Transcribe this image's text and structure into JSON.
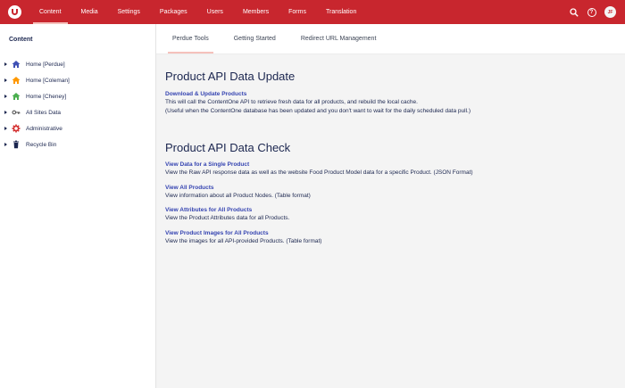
{
  "topbar": {
    "logo_name": "umbraco-logo",
    "nav": [
      {
        "label": "Content",
        "active": true
      },
      {
        "label": "Media"
      },
      {
        "label": "Settings"
      },
      {
        "label": "Packages"
      },
      {
        "label": "Users"
      },
      {
        "label": "Members"
      },
      {
        "label": "Forms"
      },
      {
        "label": "Translation"
      }
    ],
    "help_glyph": "?",
    "avatar_initials": "JF"
  },
  "sidebar": {
    "title": "Content",
    "items": [
      {
        "label": "Home [Perdue]",
        "icon": "home-icon",
        "color": "#3f51b5"
      },
      {
        "label": "Home [Coleman]",
        "icon": "home-icon",
        "color": "#ff9800"
      },
      {
        "label": "Home [Cheney]",
        "icon": "home-icon",
        "color": "#4caf50"
      },
      {
        "label": "All Sites Data",
        "icon": "key-icon",
        "color": "#555555"
      },
      {
        "label": "Administrative",
        "icon": "gear-icon",
        "color": "#d32f2f"
      },
      {
        "label": "Recycle Bin",
        "icon": "trash-icon",
        "color": "#1b264f"
      }
    ]
  },
  "main": {
    "tabs": [
      {
        "label": "Perdue Tools",
        "active": true
      },
      {
        "label": "Getting Started"
      },
      {
        "label": "Redirect URL Management"
      }
    ],
    "section1": {
      "title": "Product API Data Update",
      "entries": [
        {
          "link": "Download & Update Products",
          "desc1": "This will call the ContentOne API to retrieve fresh data for all products, and rebuild the local cache.",
          "desc2": "(Useful when the ContentOne database has been updated and you don't want to wait for the daily scheduled data pull.)"
        }
      ]
    },
    "section2": {
      "title": "Product API Data Check",
      "entries": [
        {
          "link": "View Data for a Single Product",
          "desc1": "View the Raw API response data as well as the website Food Product Model data for a specific Product. (JSON Format)"
        },
        {
          "link": "View All Products",
          "desc1": "View information about all Product Nodes. (Table format)"
        },
        {
          "link": "View Attributes for All Products",
          "desc1": "View the Product Attributes data for all Products."
        },
        {
          "link": "View Product Images for All Products",
          "desc1": "View the images for all API-provided Products. (Table format)"
        }
      ]
    }
  },
  "colors": {
    "topbar": "#c8262e",
    "link": "#3544b1",
    "text": "#1b264f",
    "active_underline": "#f5c1bc"
  }
}
